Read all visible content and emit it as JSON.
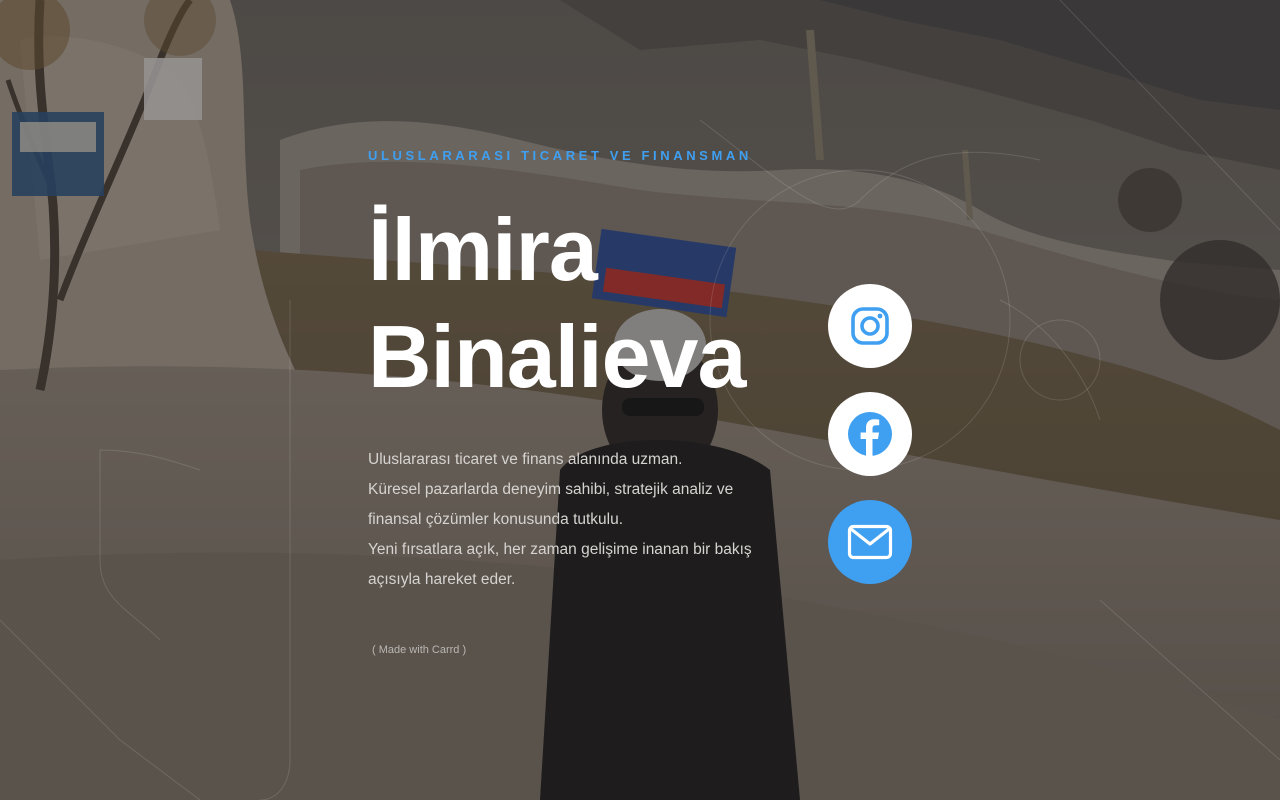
{
  "header": {
    "eyebrow": "ULUSLARARASI TICARET VE FINANSMAN",
    "name_line1": "İlmira",
    "name_line2": "Binalieva"
  },
  "bio": {
    "line1": "Uluslararası ticaret ve finans alanında uzman.",
    "line2": "Küresel pazarlarda deneyim sahibi, stratejik analiz ve",
    "line3": "finansal çözümler konusunda tutkulu.",
    "line4": "Yeni fırsatlara açık, her zaman gelişime inanan bir bakış",
    "line5": "açısıyla hareket eder."
  },
  "footer": {
    "credit_open": "( ",
    "credit_label": "Made with Carrd",
    "credit_close": " )"
  },
  "socials": [
    {
      "icon": "instagram-icon"
    },
    {
      "icon": "facebook-icon"
    },
    {
      "icon": "mail-icon"
    }
  ],
  "colors": {
    "accent": "#3f9ff0",
    "text_primary": "#ffffff",
    "text_body": "#d6d3d0"
  }
}
